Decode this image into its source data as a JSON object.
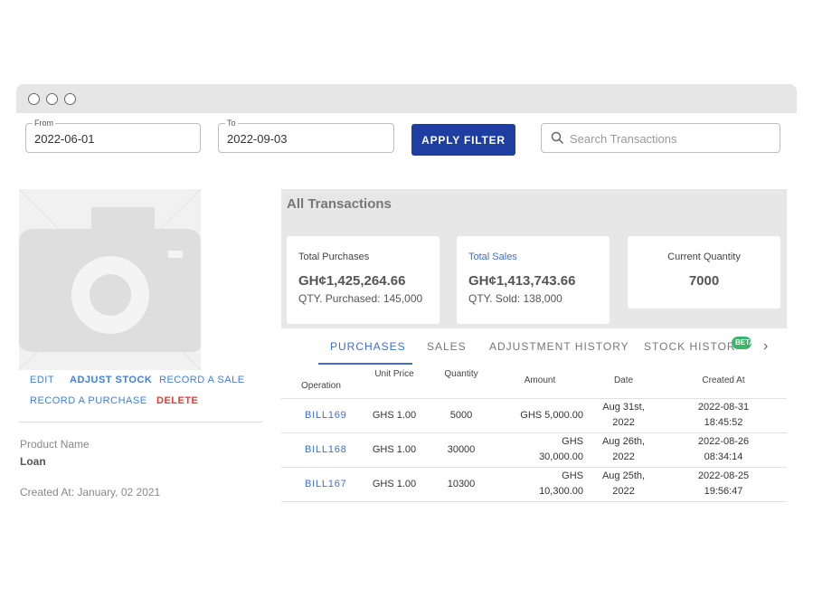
{
  "filters": {
    "from_label": "From",
    "from_value": "2022-06-01",
    "to_label": "To",
    "to_value": "2022-09-03",
    "apply_label": "APPLY FILTER",
    "search_placeholder": "Search Transactions"
  },
  "actions": {
    "edit": "EDIT",
    "adjust_stock": "ADJUST STOCK",
    "record_sale": "RECORD A SALE",
    "record_purchase": "RECORD A PURCHASE",
    "delete": "DELETE"
  },
  "product": {
    "name_label": "Product Name",
    "name_value": "Loan",
    "created_text": "Created At: January, 02 2021"
  },
  "summary": {
    "title": "All Transactions",
    "cards": [
      {
        "title": "Total Purchases",
        "value": "GH¢1,425,264.66",
        "sub": "QTY. Purchased: 145,000"
      },
      {
        "title": "Total Sales",
        "value": "GH¢1,413,743.66",
        "sub": "QTY. Sold: 138,000"
      },
      {
        "title": "Current Quantity",
        "value": "7000"
      }
    ]
  },
  "tabs": {
    "items": [
      "PURCHASES",
      "SALES",
      "ADJUSTMENT HISTORY",
      "STOCK HISTOR"
    ],
    "badge": "BETA",
    "active": "PURCHASES"
  },
  "table": {
    "headers": [
      "Operation",
      "Unit Price",
      "Quantity",
      "Amount",
      "Date",
      "Created At"
    ],
    "rows": [
      {
        "op": "BILL169",
        "price": "GHS 1.00",
        "qty": "5000",
        "amt1": "GHS 5,000.00",
        "amt2": "",
        "date1": "Aug 31st,",
        "date2": "2022",
        "c1": "2022-08-31",
        "c2": "18:45:52"
      },
      {
        "op": "BILL168",
        "price": "GHS 1.00",
        "qty": "30000",
        "amt1": "GHS",
        "amt2": "30,000.00",
        "date1": "Aug 26th,",
        "date2": "2022",
        "c1": "2022-08-26",
        "c2": "08:34:14"
      },
      {
        "op": "BILL167",
        "price": "GHS 1.00",
        "qty": "10300",
        "amt1": "GHS",
        "amt2": "10,300.00",
        "date1": "Aug 25th,",
        "date2": "2022",
        "c1": "2022-08-25",
        "c2": "19:56:47"
      }
    ]
  },
  "colors": {
    "primary": "#1f3fa0",
    "link": "#3f6ec8",
    "danger": "#e03b3b",
    "badge": "#3bb56a"
  }
}
